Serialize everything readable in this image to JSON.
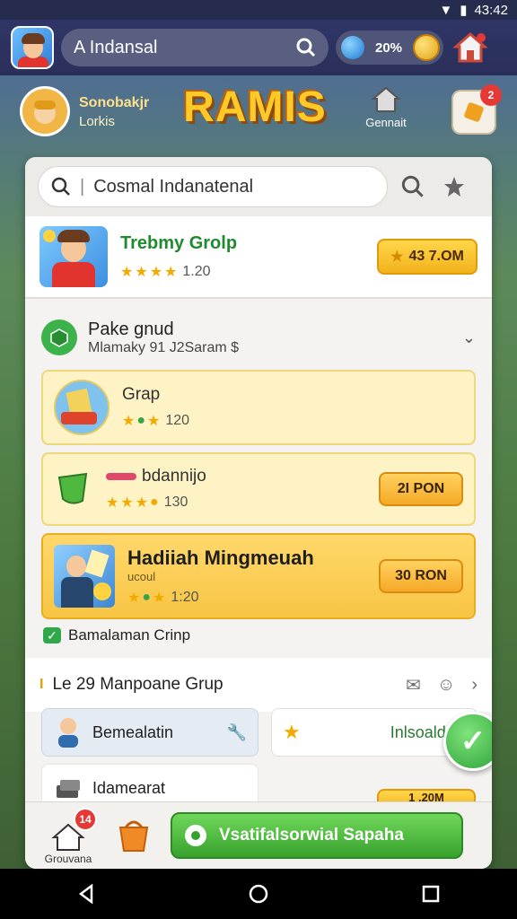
{
  "status_bar": {
    "time": "43:42"
  },
  "top_bar": {
    "search_text": "A Indansal",
    "coins_label": "20%",
    "icons": [
      "app-icon",
      "search-icon",
      "gem-icon",
      "coin-icon",
      "home-icon"
    ]
  },
  "game": {
    "logo": "RAMIS",
    "player_name": "Sonobakjr",
    "player_sub": "Lorkis",
    "general_label": "Gennait",
    "corner_badge": "2"
  },
  "panel": {
    "search_text": "Cosmal Indanatenal",
    "top_card": {
      "title": "Trebmy Grolp",
      "rating": "1.20",
      "button": "43 7.OM"
    },
    "group": {
      "title": "Pake gnud",
      "subtitle": "Mlamaky 91 J2Saram $"
    },
    "cards": [
      {
        "name": "Grap",
        "rating": "120",
        "button": ""
      },
      {
        "name": "bdannijo",
        "rating": "130",
        "button": "2I PON"
      },
      {
        "name": "Hadiiah Mingmeuah",
        "sub": "ucoul",
        "rating": "1:20",
        "button": "30 RON"
      }
    ],
    "check_label": "Bamalaman Crinp",
    "section2": {
      "prefix": "I",
      "title": "Le 29 Manpoane Grup"
    },
    "tiles": {
      "blue": "Bemealatin",
      "white": "Inlsoald",
      "plain": "Idamearat"
    },
    "peek_label": "1 .20M",
    "bottom": {
      "home_label": "Grouvana",
      "home_badge": "14",
      "action_label": "Vsatifalsorwial Sapaha"
    }
  },
  "colors": {
    "accent_green": "#37a12d",
    "gold": "#f2b31c",
    "title_green": "#1f8a2f"
  }
}
